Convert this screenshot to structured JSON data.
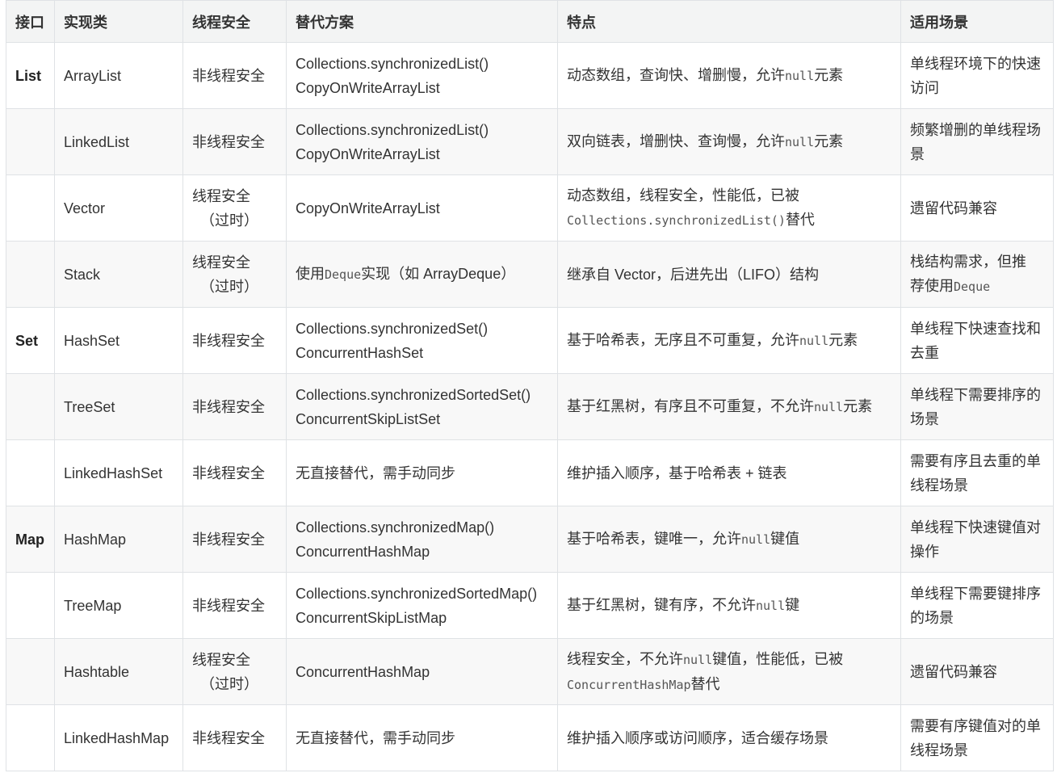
{
  "headers": [
    "接口",
    "实现类",
    "线程安全",
    "替代方案",
    "特点",
    "适用场景"
  ],
  "rows": [
    {
      "iface": "List",
      "impl": "ArrayList",
      "safe": [
        "非线程安全"
      ],
      "alt": [
        "Collections.synchronizedList()",
        "CopyOnWriteArrayList"
      ],
      "feat": [
        {
          "t": "动态数组，查询快、增删慢，允许"
        },
        {
          "c": "null"
        },
        {
          "t": "元素"
        }
      ],
      "scene": [
        {
          "t": "单线程环境下的快速访问"
        }
      ]
    },
    {
      "iface": "",
      "impl": "LinkedList",
      "safe": [
        "非线程安全"
      ],
      "alt": [
        "Collections.synchronizedList()",
        "CopyOnWriteArrayList"
      ],
      "feat": [
        {
          "t": "双向链表，增删快、查询慢，允许"
        },
        {
          "c": "null"
        },
        {
          "t": "元素"
        }
      ],
      "scene": [
        {
          "t": "频繁增删的单线程场景"
        }
      ]
    },
    {
      "iface": "",
      "impl": "Vector",
      "safe": [
        "线程安全",
        "（过时）"
      ],
      "alt": [
        "CopyOnWriteArrayList"
      ],
      "feat": [
        {
          "t": "动态数组，线程安全，性能低，已被"
        },
        {
          "br": true
        },
        {
          "c": "Collections.synchronizedList()"
        },
        {
          "t": "替代"
        }
      ],
      "scene": [
        {
          "t": "遗留代码兼容"
        }
      ]
    },
    {
      "iface": "",
      "impl": "Stack",
      "safe": [
        "线程安全",
        "（过时）"
      ],
      "alt_mixed": [
        {
          "t": "使用"
        },
        {
          "c": "Deque"
        },
        {
          "t": "实现（如 ArrayDeque）"
        }
      ],
      "feat": [
        {
          "t": "继承自 Vector，后进先出（LIFO）结构"
        }
      ],
      "scene": [
        {
          "t": "栈结构需求，但推"
        },
        {
          "br": true
        },
        {
          "t": "荐使用"
        },
        {
          "c": "Deque"
        }
      ]
    },
    {
      "iface": "Set",
      "impl": "HashSet",
      "safe": [
        "非线程安全"
      ],
      "alt": [
        "Collections.synchronizedSet()",
        "ConcurrentHashSet"
      ],
      "feat": [
        {
          "t": "基于哈希表，无序且不可重复，允许"
        },
        {
          "c": "null"
        },
        {
          "t": "元素"
        }
      ],
      "scene": [
        {
          "t": "单线程下快速查找和去重"
        }
      ]
    },
    {
      "iface": "",
      "impl": "TreeSet",
      "safe": [
        "非线程安全"
      ],
      "alt": [
        "Collections.synchronizedSortedSet()",
        "ConcurrentSkipListSet"
      ],
      "feat": [
        {
          "t": "基于红黑树，有序且不可重复，不允许"
        },
        {
          "c": "null"
        },
        {
          "t": "元素"
        }
      ],
      "scene": [
        {
          "t": "单线程下需要排序的场景"
        }
      ]
    },
    {
      "iface": "",
      "impl": "LinkedHashSet",
      "safe": [
        "非线程安全"
      ],
      "alt": [
        "无直接替代，需手动同步"
      ],
      "feat": [
        {
          "t": "维护插入顺序，基于哈希表 + 链表"
        }
      ],
      "scene": [
        {
          "t": "需要有序且去重的单线程场景"
        }
      ]
    },
    {
      "iface": "Map",
      "impl": "HashMap",
      "safe": [
        "非线程安全"
      ],
      "alt": [
        "Collections.synchronizedMap()",
        "ConcurrentHashMap"
      ],
      "feat": [
        {
          "t": "基于哈希表，键唯一，允许"
        },
        {
          "c": "null"
        },
        {
          "t": "键值"
        }
      ],
      "scene": [
        {
          "t": "单线程下快速键值对操作"
        }
      ]
    },
    {
      "iface": "",
      "impl": "TreeMap",
      "safe": [
        "非线程安全"
      ],
      "alt": [
        "Collections.synchronizedSortedMap()",
        "ConcurrentSkipListMap"
      ],
      "feat": [
        {
          "t": "基于红黑树，键有序，不允许"
        },
        {
          "c": "null"
        },
        {
          "t": "键"
        }
      ],
      "scene": [
        {
          "t": "单线程下需要键排序的场景"
        }
      ]
    },
    {
      "iface": "",
      "impl": "Hashtable",
      "safe": [
        "线程安全",
        "（过时）"
      ],
      "alt": [
        "ConcurrentHashMap"
      ],
      "feat": [
        {
          "t": "线程安全，不允许"
        },
        {
          "c": "null"
        },
        {
          "t": "键值，性能低，已被"
        },
        {
          "br": true
        },
        {
          "c": "ConcurrentHashMap"
        },
        {
          "t": "替代"
        }
      ],
      "scene": [
        {
          "t": "遗留代码兼容"
        }
      ]
    },
    {
      "iface": "",
      "impl": "LinkedHashMap",
      "safe": [
        "非线程安全"
      ],
      "alt": [
        "无直接替代，需手动同步"
      ],
      "feat": [
        {
          "t": "维护插入顺序或访问顺序，适合缓存场景"
        }
      ],
      "scene": [
        {
          "t": "需要有序键值对的单线程场景"
        }
      ]
    }
  ]
}
